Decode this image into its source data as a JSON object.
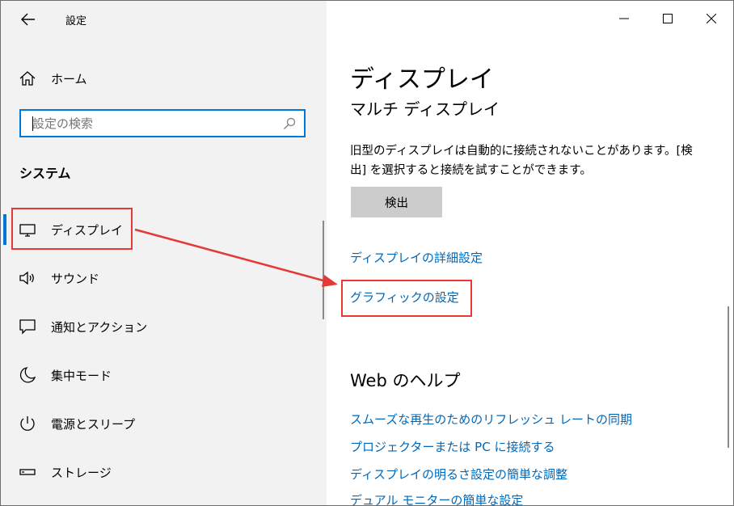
{
  "window": {
    "app_title": "設定",
    "controls": {
      "minimize": "—",
      "maximize": "☐",
      "close": "✕"
    }
  },
  "sidebar": {
    "home_label": "ホーム",
    "search": {
      "placeholder": "設定の検索"
    },
    "section_title": "システム",
    "items": [
      {
        "label": "ディスプレイ",
        "icon": "monitor-icon",
        "selected": true
      },
      {
        "label": "サウンド",
        "icon": "speaker-icon"
      },
      {
        "label": "通知とアクション",
        "icon": "notification-icon"
      },
      {
        "label": "集中モード",
        "icon": "moon-icon"
      },
      {
        "label": "電源とスリープ",
        "icon": "power-icon"
      },
      {
        "label": "ストレージ",
        "icon": "storage-icon"
      }
    ]
  },
  "main": {
    "page_title": "ディスプレイ",
    "section_title": "マルチ ディスプレイ",
    "description": "旧型のディスプレイは自動的に接続されないことがあります。[検出] を選択すると接続を試すことができます。",
    "detect_button": "検出",
    "links": {
      "advanced_display": "ディスプレイの詳細設定",
      "graphics_settings": "グラフィックの設定"
    },
    "help": {
      "title": "Web のヘルプ",
      "links": [
        "スムーズな再生のためのリフレッシュ レートの同期",
        "プロジェクターまたは PC に接続する",
        "ディスプレイの明るさ設定の簡単な調整",
        "デュアル モニターの簡単な設定"
      ]
    }
  },
  "colors": {
    "accent": "#0078d7",
    "link": "#0067b8",
    "annotation": "#e53935",
    "sidebar_bg": "#f2f2f2"
  }
}
